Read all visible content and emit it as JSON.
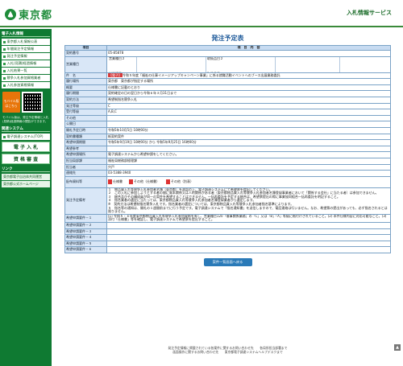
{
  "header": {
    "logo_name": "東京都",
    "service_title": "入札情報サービス"
  },
  "sidebar": {
    "section1_title": "電子入札情報",
    "items": [
      {
        "label": "東京都入札情報公表"
      },
      {
        "label": "年間発注予定情報"
      },
      {
        "label": "発注予定情報"
      },
      {
        "label": "入札(見積)経過情報"
      },
      {
        "label": "入札結果一覧"
      },
      {
        "label": "競争入札参加資格業者"
      },
      {
        "label": "入札参加資格情報"
      }
    ],
    "mobile_button": "モバイル版はこちら",
    "mobile_note": "モバイル版は、発注予定情報と入札(見積)経過情報の閲覧ができます。",
    "section2_title": "関連システム",
    "links": [
      {
        "label": "電子調達システム(TOP)"
      },
      {
        "label": "電 子 入 札"
      },
      {
        "label": "資 格 審 査"
      }
    ],
    "section3_title": "リンク",
    "ext_links": [
      {
        "label": "東京都電子自治体共同運営"
      },
      {
        "label": "東京都公式ホームページ"
      }
    ]
  },
  "page": {
    "title": "発注予定表",
    "table_head_left": "項目",
    "table_head_right": "項　目　内　容"
  },
  "table": {
    "rows": [
      {
        "label": "契約番号",
        "value": "05-85878"
      },
      {
        "label": "営業種目",
        "type": "sub",
        "cells": [
          [
            "営業種目１",
            "120 催事関係業務",
            "取扱品目１",
            ""
          ],
          [
            "営業種目２",
            "",
            "取扱品目２",
            ""
          ],
          [
            "営業種目３",
            "",
            "取扱品目３",
            ""
          ]
        ]
      },
      {
        "label": "件　名",
        "tag": "【電子】",
        "value": "令和５年度「福祉の仕事イメージアップキャンペーン事業」に係る就職活動イベントへのブース出展業務委託"
      },
      {
        "label": "履行場所",
        "value": "東京都　東京都が指定する場所"
      },
      {
        "label": "概要",
        "value": "仕様書に記載のとおり"
      },
      {
        "label": "履行期間",
        "value": "契約確定の日の翌日から令和６年３月31日まで"
      },
      {
        "label": "契約方法",
        "value": "希望制指名競争入札"
      },
      {
        "label": "発注等級",
        "value": "C"
      },
      {
        "label": "受付等級",
        "value": "A,B,C"
      },
      {
        "label": "その他",
        "value": ""
      },
      {
        "label": "公開日",
        "value": ""
      },
      {
        "label": "開札予定日時",
        "value": "令和5年10月5日 10時00分"
      },
      {
        "label": "契約書種類",
        "value": "紙契約案件"
      },
      {
        "label": "希望申請期間",
        "value": "令和5年9月19日 10時00分 から 令和5年9月25日 16時00分"
      },
      {
        "label": "希望参考",
        "value": ""
      },
      {
        "label": "希望申請場所",
        "value": "電子調達システムから希望申請をしてください。"
      },
      {
        "label": "担当局部課",
        "value": "福祉局総務部経理課"
      },
      {
        "label": "担当者",
        "value": "宍戸"
      },
      {
        "label": "連絡先",
        "value": "03-5388-3940"
      }
    ],
    "docs_label": "配布資料等",
    "doc1": "仕様書",
    "doc2": "その他（仕様書）",
    "doc3": "その他（別表）",
    "notes_label": "発注予定備考",
    "notes": [
      "１　物品買入れ等競争入札参加者名簿（東京都）を承認の上、電子調達システムにて希望票を提出してください。",
      "２　この入札に参加しようとする者の間に資本関係又は人的関係がある者（東京都物品買入れ等競争入札参加者名簿登録事業者において「関係する会社」に当たる者）は参加できません。",
      "３　総合及びその構成員が同一の案件を希望することはできません。一括再委託を予定する総合は、希望票提出の際に事業協同組合一括再委託を明記すること。",
      "４　指名業者の選定に当たっては、東京都物品買入れ等競争入札参加者名簿登録業者から選定します。",
      "※　契約方法は希望制指名競争入札です。指名業者の選定については、東京都物品買入れ等競争入札参加者指名基準によります。",
      "５　指名等の通知は、開札の１週間前までに行う予定です。電子調達システムで「指名通知書」を送信しますので、電話連絡は行いません。なお、希望票の提出があっても、必ず指名されるとは限りません。"
    ],
    "cond_label": "希望申請要件－１",
    "cond_value": "(1) 令和５・６年度東京都物品買入れ等競争入札参加資格を有し、営業種目120「催事関係業務」の「C」又は「B」「A」等級に格付けされていること。(2) 本件仕様内容に対応可能なこと。(3) 添付「仕様書」等を確認し、電子調達システムで希望票を提出すること。",
    "cond_rows": [
      {
        "label": "希望申請要件－２",
        "value": ""
      },
      {
        "label": "希望申請要件－３",
        "value": ""
      },
      {
        "label": "希望申請要件－４",
        "value": ""
      },
      {
        "label": "希望申請要件－５",
        "value": ""
      },
      {
        "label": "希望申請要件－６",
        "value": ""
      }
    ]
  },
  "back_button": "案件一覧画面へ戻る",
  "footer": {
    "line1": "発注予定情報に掲載されている各案件に関するお問い合わせ先　　各局所担当部署まで",
    "line2": "画面操作に関するお問い合わせ先　　東京都電子調達システムヘルプデスクまで"
  }
}
